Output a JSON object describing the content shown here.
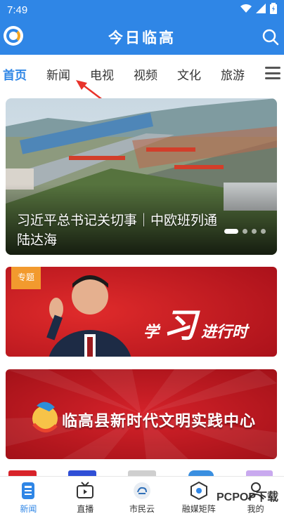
{
  "status_bar": {
    "time": "7:49"
  },
  "header": {
    "title": "今日临高"
  },
  "tabs": [
    {
      "label": "首页",
      "active": true
    },
    {
      "label": "新闻",
      "active": false
    },
    {
      "label": "电视",
      "active": false
    },
    {
      "label": "视频",
      "active": false
    },
    {
      "label": "文化",
      "active": false
    },
    {
      "label": "旅游",
      "active": false
    }
  ],
  "banner": {
    "caption": "习近平总书记关切事｜中欧班列通陆达海",
    "slide_count": 5,
    "active_slide": 1
  },
  "cards": [
    {
      "tag": "专题",
      "text_small_1": "学",
      "text_big": "习",
      "text_small_2": "进行时"
    },
    {
      "title": "临高县新时代文明实践中心"
    }
  ],
  "bottom_nav": [
    {
      "label": "新闻",
      "icon": "news-icon",
      "active": true
    },
    {
      "label": "直播",
      "icon": "tv-icon",
      "active": false
    },
    {
      "label": "市民云",
      "icon": "citizen-cloud-icon",
      "active": false
    },
    {
      "label": "融媒矩阵",
      "icon": "media-matrix-icon",
      "active": false
    },
    {
      "label": "我的",
      "icon": "profile-icon",
      "active": false
    }
  ],
  "watermark": {
    "text": "PCPOP下载"
  },
  "colors": {
    "primary": "#2f86e6",
    "accent_orange": "#f29a2e",
    "banner_red": "#c8102e"
  }
}
